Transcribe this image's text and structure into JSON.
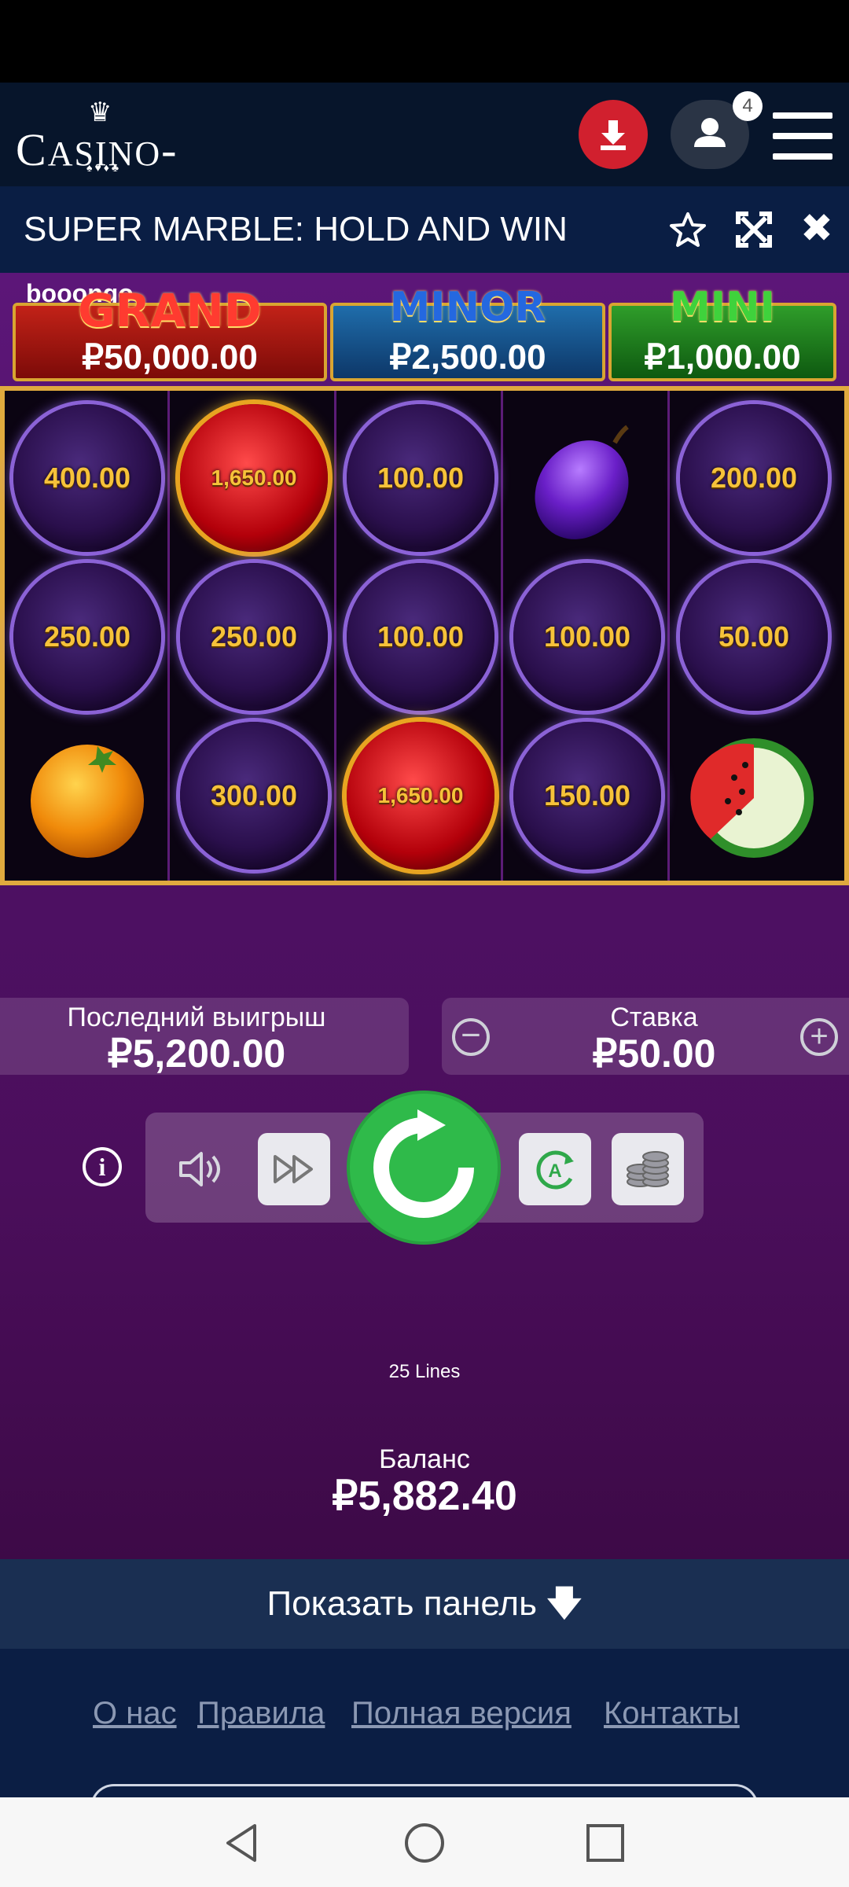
{
  "header": {
    "logo_text": "CASINO-Z",
    "notification_count": "4"
  },
  "title_bar": {
    "game_title": "SUPER MARBLE: HOLD AND WIN"
  },
  "game": {
    "brand": "booongo",
    "jackpots": [
      {
        "name": "GRAND",
        "value": "₽50,000.00"
      },
      {
        "name": "MINOR",
        "value": "₽2,500.00"
      },
      {
        "name": "MINI",
        "value": "₽1,000.00"
      }
    ],
    "reels": [
      [
        "400.00",
        "250.00",
        "orange"
      ],
      [
        "1,650.00",
        "250.00",
        "300.00"
      ],
      [
        "100.00",
        "100.00",
        "1,650.00"
      ],
      [
        "plum",
        "100.00",
        "150.00"
      ],
      [
        "200.00",
        "50.00",
        "watermelon"
      ]
    ],
    "last_win": {
      "label": "Последний выигрыш",
      "value": "₽5,200.00"
    },
    "stake": {
      "label": "Ставка",
      "value": "₽50.00"
    },
    "lines": "25 Lines",
    "balance": {
      "label": "Баланс",
      "value": "₽5,882.40"
    }
  },
  "show_panel": "Показать панель",
  "footer": {
    "links": [
      "О нас",
      "Правила",
      "Полная версия",
      "Контакты"
    ]
  },
  "colors": {
    "header_bg": "#07152b",
    "title_bar_bg": "#0a1e44",
    "accent_red": "#d1202e",
    "spin_green": "#2fba4a",
    "reel_border_gold": "#e0aa3e"
  }
}
